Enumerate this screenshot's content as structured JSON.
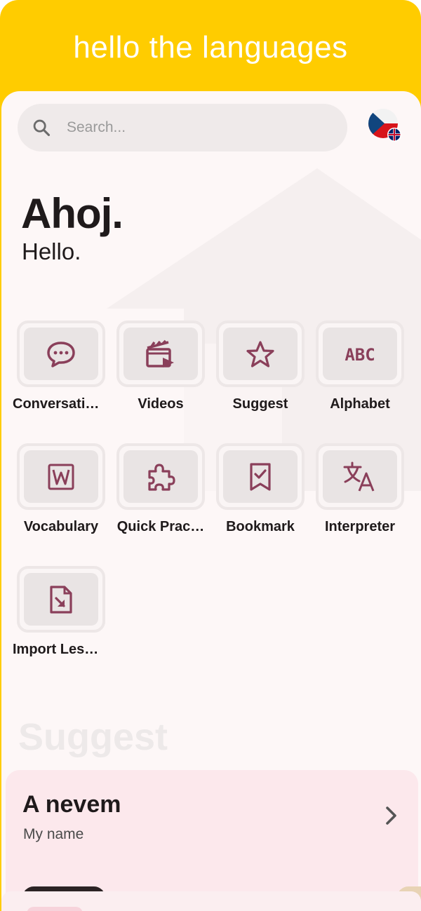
{
  "header": {
    "title": "hello the languages"
  },
  "search": {
    "placeholder": "Search..."
  },
  "language": {
    "flag": "czech-flag",
    "badge": "uk-flag"
  },
  "greeting": {
    "main": "Ahoj.",
    "sub": "Hello."
  },
  "menu": {
    "items": [
      {
        "label": "Conversati…",
        "icon": "chat-bubble-icon"
      },
      {
        "label": "Videos",
        "icon": "clapperboard-icon"
      },
      {
        "label": "Suggest",
        "icon": "star-icon"
      },
      {
        "label": "Alphabet",
        "icon": "abc-icon"
      },
      {
        "label": "Vocabulary",
        "icon": "word-doc-icon"
      },
      {
        "label": "Quick Prac…",
        "icon": "puzzle-icon"
      },
      {
        "label": "Bookmark",
        "icon": "bookmark-check-icon"
      },
      {
        "label": "Interpreter",
        "icon": "translate-icon"
      },
      {
        "label": "Import Les…",
        "icon": "file-import-icon"
      }
    ]
  },
  "suggest": {
    "heading": "Suggest",
    "card": {
      "title": "A nevem",
      "subtitle": "My name"
    }
  },
  "colors": {
    "banner": "#FFCC00",
    "icon": "#8A3F5A",
    "card": "#FCE8EC"
  }
}
